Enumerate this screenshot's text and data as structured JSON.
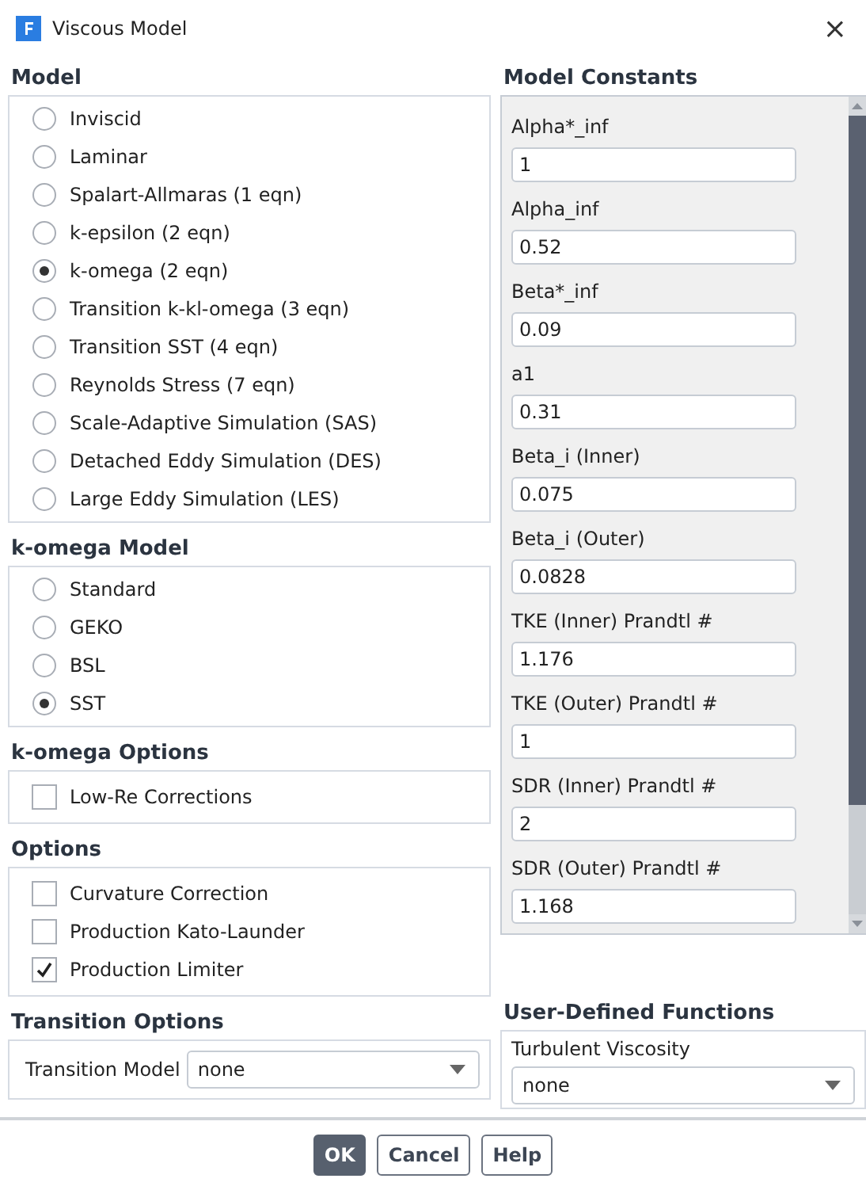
{
  "window": {
    "title": "Viscous Model",
    "close": "×"
  },
  "model": {
    "title": "Model",
    "options": [
      {
        "label": "Inviscid",
        "selected": false
      },
      {
        "label": "Laminar",
        "selected": false
      },
      {
        "label": "Spalart-Allmaras (1 eqn)",
        "selected": false
      },
      {
        "label": "k-epsilon (2 eqn)",
        "selected": false
      },
      {
        "label": "k-omega (2 eqn)",
        "selected": true
      },
      {
        "label": "Transition k-kl-omega (3 eqn)",
        "selected": false
      },
      {
        "label": "Transition SST (4 eqn)",
        "selected": false
      },
      {
        "label": "Reynolds Stress (7 eqn)",
        "selected": false
      },
      {
        "label": "Scale-Adaptive Simulation (SAS)",
        "selected": false
      },
      {
        "label": "Detached Eddy Simulation (DES)",
        "selected": false
      },
      {
        "label": "Large Eddy Simulation (LES)",
        "selected": false
      }
    ]
  },
  "k_omega_model": {
    "title": "k-omega Model",
    "options": [
      {
        "label": "Standard",
        "selected": false
      },
      {
        "label": "GEKO",
        "selected": false
      },
      {
        "label": "BSL",
        "selected": false
      },
      {
        "label": "SST",
        "selected": true
      }
    ]
  },
  "k_omega_options": {
    "title": "k-omega Options",
    "checkboxes": [
      {
        "label": "Low-Re Corrections",
        "checked": false
      }
    ]
  },
  "options": {
    "title": "Options",
    "checkboxes": [
      {
        "label": "Curvature Correction",
        "checked": false
      },
      {
        "label": "Production Kato-Launder",
        "checked": false
      },
      {
        "label": "Production Limiter",
        "checked": true
      }
    ]
  },
  "transition_options": {
    "title": "Transition Options",
    "label": "Transition Model",
    "value": "none"
  },
  "model_constants": {
    "title": "Model Constants",
    "fields": [
      {
        "label": "Alpha*_inf",
        "value": "1"
      },
      {
        "label": "Alpha_inf",
        "value": "0.52"
      },
      {
        "label": "Beta*_inf",
        "value": "0.09"
      },
      {
        "label": "a1",
        "value": "0.31"
      },
      {
        "label": "Beta_i (Inner)",
        "value": "0.075"
      },
      {
        "label": "Beta_i (Outer)",
        "value": "0.0828"
      },
      {
        "label": "TKE (Inner) Prandtl #",
        "value": "1.176"
      },
      {
        "label": "TKE (Outer) Prandtl #",
        "value": "1"
      },
      {
        "label": "SDR (Inner) Prandtl #",
        "value": "2"
      },
      {
        "label": "SDR (Outer) Prandtl #",
        "value": "1.168"
      }
    ]
  },
  "user_defined_functions": {
    "title": "User-Defined Functions",
    "label": "Turbulent Viscosity",
    "value": "none"
  },
  "buttons": [
    {
      "label": "OK",
      "default": true
    },
    {
      "label": "Cancel",
      "default": false
    },
    {
      "label": "Help",
      "default": false
    }
  ]
}
